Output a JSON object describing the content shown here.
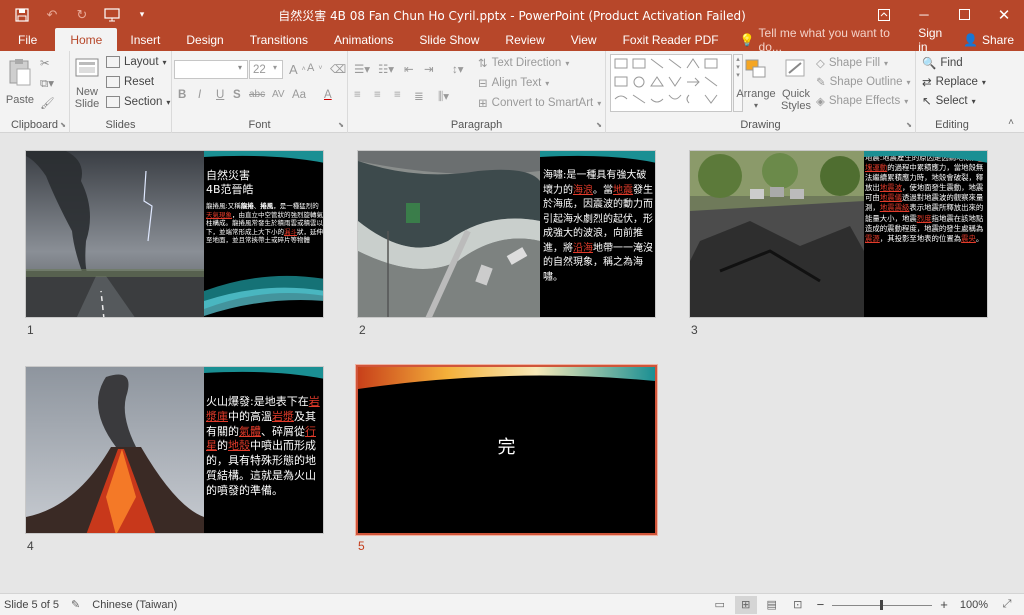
{
  "titlebar": {
    "title": "自然災害 4B 08 Fan Chun Ho Cyril.pptx - PowerPoint (Product Activation Failed)",
    "save_icon": "save-icon",
    "undo_icon": "undo-icon",
    "redo_icon": "redo-icon",
    "present_icon": "start-from-beginning-icon",
    "customize_icon": "customize-qat-icon"
  },
  "tabs": [
    "File",
    "Home",
    "Insert",
    "Design",
    "Transitions",
    "Animations",
    "Slide Show",
    "Review",
    "View",
    "Foxit Reader PDF"
  ],
  "active_tab": "Home",
  "tell_me": "Tell me what you want to do...",
  "sign_in": "Sign in",
  "share": "Share",
  "ribbon": {
    "clipboard": {
      "label": "Clipboard",
      "paste": "Paste"
    },
    "slides": {
      "label": "Slides",
      "new_slide_1": "New",
      "new_slide_2": "Slide",
      "layout": "Layout",
      "reset": "Reset",
      "section": "Section"
    },
    "font": {
      "label": "Font",
      "font_name": "",
      "font_size": "22",
      "bold": "B",
      "italic": "I",
      "underline": "U",
      "shadow": "S",
      "strike": "abc",
      "spacing": "AV",
      "case": "Aa"
    },
    "paragraph": {
      "label": "Paragraph",
      "text_direction": "Text Direction",
      "align_text": "Align Text",
      "smartart": "Convert to SmartArt"
    },
    "drawing": {
      "label": "Drawing",
      "arrange": "Arrange",
      "quick_styles_1": "Quick",
      "quick_styles_2": "Styles",
      "shape_fill": "Shape Fill",
      "shape_outline": "Shape Outline",
      "shape_effects": "Shape Effects"
    },
    "editing": {
      "label": "Editing",
      "find": "Find",
      "replace": "Replace",
      "select": "Select"
    }
  },
  "slides": [
    {
      "number": "1",
      "title1": "自然災害",
      "title2": "4B范晉皓",
      "body_parts": [
        {
          "t": "龍捲風:又稱"
        },
        {
          "t": "龍捲",
          "b": true
        },
        {
          "t": "、"
        },
        {
          "t": "捲風",
          "b": true
        },
        {
          "t": "，是一種猛烈的"
        },
        {
          "t": "天氣現象",
          "r": true
        },
        {
          "t": "，由直立中空管狀的強烈旋轉氣柱構成。龍捲風常發生於積雨雲或積雲以下，並端常形成上大下小的"
        },
        {
          "t": "漏斗",
          "r": true
        },
        {
          "t": "狀，延伸至地面，並且常挾帶土或碎片等物體"
        }
      ]
    },
    {
      "number": "2",
      "body_parts": [
        {
          "t": "海嘯:是一種具有強大破壞力的"
        },
        {
          "t": "海浪",
          "r": true
        },
        {
          "t": "。當"
        },
        {
          "t": "地震",
          "r": true
        },
        {
          "t": "發生於海底，因震波的動力而引起海水劇烈的起伏，形成強大的波浪，向前推進，將"
        },
        {
          "t": "沿海",
          "r": true
        },
        {
          "t": "地帶一一淹沒的自然現象，稱之為海嘯。"
        }
      ]
    },
    {
      "number": "3",
      "body_parts": [
        {
          "t": "地震:地震產生的原因是因為地殼在"
        },
        {
          "t": "板塊運動",
          "r": true
        },
        {
          "t": "的過程中累積應力，當地殼無法繼續累積應力時，地殼會破裂，釋放出"
        },
        {
          "t": "地震波",
          "r": true
        },
        {
          "t": "，使地面發生震動，地震可由"
        },
        {
          "t": "地震儀",
          "r": true
        },
        {
          "t": "透過對地震波的觀察來量測，"
        },
        {
          "t": "地震震級",
          "r": true
        },
        {
          "t": "表示地震所釋放出來的能量大小，地震"
        },
        {
          "t": "烈度",
          "r": true
        },
        {
          "t": "指地震在該地點造成的震動程度，地震的發生處稱為"
        },
        {
          "t": "震源",
          "r": true
        },
        {
          "t": "，其投影至地表的位置為"
        },
        {
          "t": "震央",
          "r": true
        },
        {
          "t": "。"
        }
      ]
    },
    {
      "number": "4",
      "body_parts": [
        {
          "t": "火山爆發:是地表下在"
        },
        {
          "t": "岩漿庫",
          "r": true
        },
        {
          "t": "中的高溫"
        },
        {
          "t": "岩漿",
          "r": true
        },
        {
          "t": "及其有關的"
        },
        {
          "t": "氣體",
          "r": true
        },
        {
          "t": "、碎屑從"
        },
        {
          "t": "行星",
          "r": true
        },
        {
          "t": "的"
        },
        {
          "t": "地殼",
          "r": true
        },
        {
          "t": "中噴出而形成的，具有特殊形態的地質結構。這就是為火山的噴發的準備。"
        }
      ]
    },
    {
      "number": "5",
      "center_text": "完"
    }
  ],
  "status": {
    "slide_info": "Slide 5 of 5",
    "language": "Chinese (Taiwan)",
    "zoom_minus": "−",
    "zoom_plus": "+",
    "zoom": "100%"
  },
  "colors": {
    "accent": "#b7472a",
    "selected_border": "#d0553a",
    "link_red": "#e23b2a"
  }
}
